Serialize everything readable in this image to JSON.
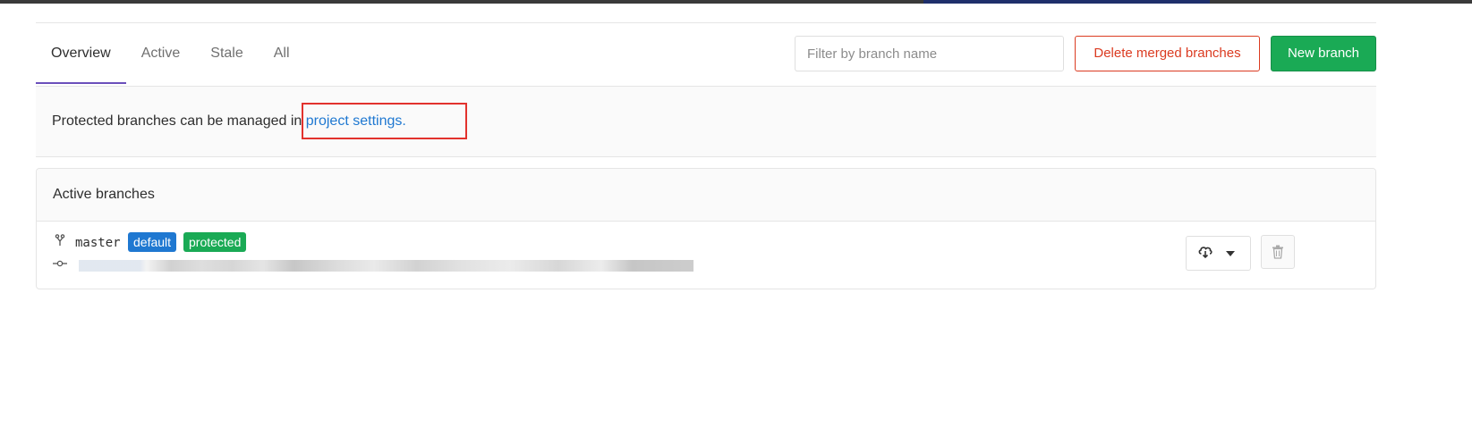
{
  "tabs": [
    {
      "label": "Overview",
      "active": true
    },
    {
      "label": "Active",
      "active": false
    },
    {
      "label": "Stale",
      "active": false
    },
    {
      "label": "All",
      "active": false
    }
  ],
  "search": {
    "placeholder": "Filter by branch name",
    "value": ""
  },
  "buttons": {
    "delete_merged": "Delete merged branches",
    "new_branch": "New branch"
  },
  "notice": {
    "text": "Protected branches can be managed in ",
    "link": "project settings",
    "suffix": "."
  },
  "panel": {
    "title": "Active branches",
    "branches": [
      {
        "name": "master",
        "badges": {
          "default": "default",
          "protected": "protected"
        },
        "icons": {
          "branch": "branch-icon",
          "commit": "commit-icon",
          "download": "cloud-download-icon",
          "delete": "trash-icon"
        }
      }
    ]
  },
  "colors": {
    "accent_tab": "#6b4fbb",
    "danger": "#db3b21",
    "success": "#1aaa55",
    "link": "#1f78d1",
    "highlight_box": "#e2322d"
  }
}
